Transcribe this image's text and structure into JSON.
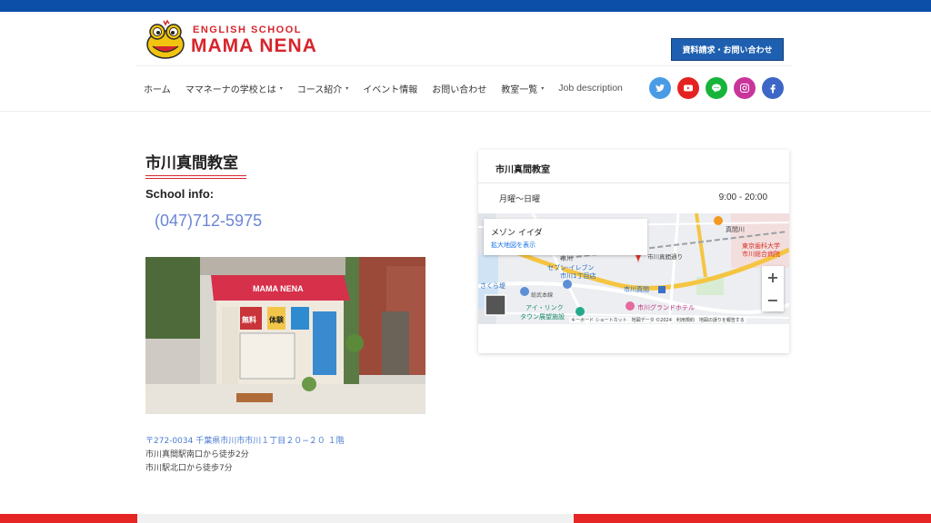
{
  "header": {
    "logo_sub": "ENGLISH SCHOOL",
    "logo_main": "MAMA NENA",
    "cta_label": "資料請求・お問い合わせ"
  },
  "nav": {
    "items": [
      {
        "label": "ホーム",
        "has_dropdown": false
      },
      {
        "label": "ママネーナの学校とは",
        "has_dropdown": true
      },
      {
        "label": "コース紹介",
        "has_dropdown": true
      },
      {
        "label": "イベント情報",
        "has_dropdown": false
      },
      {
        "label": "お問い合わせ",
        "has_dropdown": false
      },
      {
        "label": "教室一覧",
        "has_dropdown": true
      },
      {
        "label": "Job description",
        "has_dropdown": false
      }
    ],
    "caret": "▾"
  },
  "social": [
    {
      "name": "twitter-icon",
      "color": "#4a9be6"
    },
    {
      "name": "youtube-icon",
      "color": "#e52222"
    },
    {
      "name": "line-icon",
      "color": "#17b43c"
    },
    {
      "name": "instagram-icon",
      "color": "#c9359b"
    },
    {
      "name": "facebook-icon",
      "color": "#3d67c6"
    }
  ],
  "school": {
    "title": "市川真間教室",
    "info_label": "School info:",
    "phone": "(047)712-5975",
    "address": "〒272-0034 千葉県市川市市川１丁目２０−２０ １階",
    "access": [
      "市川真間駅南口から徒歩2分",
      "市川駅北口から徒歩7分"
    ]
  },
  "photo": {
    "sign_text": "MAMA NENA",
    "poster_free": "無料",
    "poster_trial": "体験"
  },
  "card": {
    "title": "市川真間教室",
    "hours_day": "月曜〜日曜",
    "hours_time": "9:00 - 20:00"
  },
  "map": {
    "place_name": "メゾン イイダ",
    "enlarge_link": "拡大地図を表示",
    "labels": {
      "station_area": "市川",
      "seven": "セブン-イレブン",
      "seven2": "市川1丁目店",
      "road": "市川真間通り",
      "hospital1": "東京歯科大学",
      "hospital2": "市川総合病院",
      "mamagawa": "真間川",
      "sakura": "さくら堤",
      "ichikawamama": "市川真間",
      "aireenku": "アイ・リンク",
      "tower": "タウン展望施設",
      "hotel": "市川グランドホテル",
      "sobu": "総武本線"
    },
    "zoom_in": "+",
    "zoom_out": "−",
    "footer": "キーボード ショートカット　地図データ ©2024　利用規約　地図の誤りを報告する"
  },
  "colors": {
    "top_bar": "#0b4fa8",
    "brand_red": "#d7252c",
    "phone_blue": "#6b86d6",
    "cta_blue": "#1e5fb0"
  }
}
